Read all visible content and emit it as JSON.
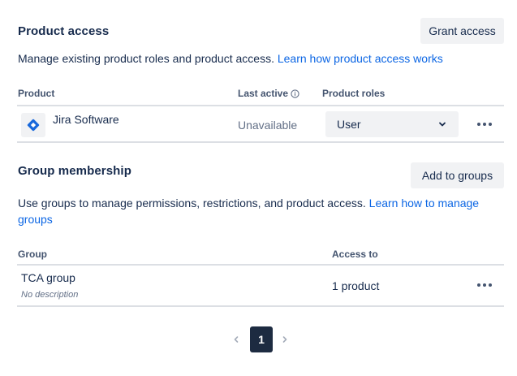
{
  "product_access": {
    "title": "Product access",
    "grant_button": "Grant access",
    "description": "Manage existing product roles and product access.",
    "learn_link": "Learn how product access works",
    "columns": {
      "product": "Product",
      "last_active": "Last active",
      "product_roles": "Product roles"
    },
    "rows": [
      {
        "product": "Jira Software",
        "last_active": "Unavailable",
        "role": "User"
      }
    ]
  },
  "group_membership": {
    "title": "Group membership",
    "add_button": "Add to groups",
    "description": "Use groups to manage permissions, restrictions, and product access.",
    "learn_link_line1": "Learn how to manage",
    "learn_link_line2": "groups",
    "columns": {
      "group": "Group",
      "access_to": "Access to"
    },
    "rows": [
      {
        "group": "TCA group",
        "description": "No description",
        "access": "1 product"
      }
    ]
  },
  "pagination": {
    "current_page": "1"
  },
  "icons": {
    "jira": "jira-software-icon",
    "info": "info-icon",
    "chevron_down": "chevron-down-icon",
    "more": "more-icon",
    "prev": "chevron-left-icon",
    "next": "chevron-right-icon"
  },
  "colors": {
    "link": "#0C66E4",
    "jira_blue": "#1868DB",
    "page_active": "#1D2B41"
  }
}
